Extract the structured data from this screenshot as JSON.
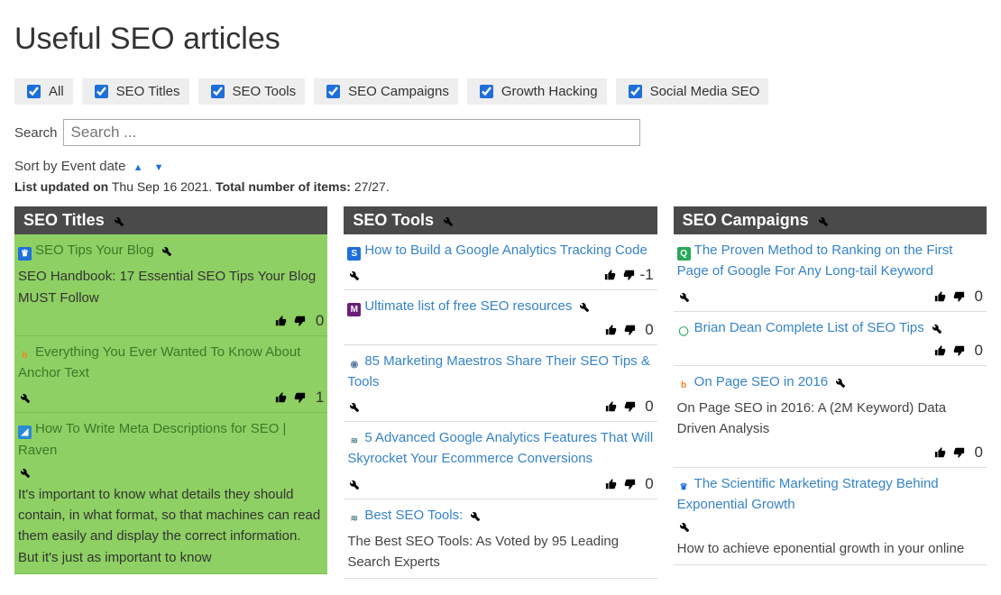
{
  "page_title": "Useful SEO articles",
  "filters": [
    {
      "label": "All",
      "checked": true
    },
    {
      "label": "SEO Titles",
      "checked": true
    },
    {
      "label": "SEO Tools",
      "checked": true
    },
    {
      "label": "SEO Campaigns",
      "checked": true
    },
    {
      "label": "Growth Hacking",
      "checked": true
    },
    {
      "label": "Social Media SEO",
      "checked": true
    }
  ],
  "search": {
    "label": "Search",
    "placeholder": "Search ..."
  },
  "sort": {
    "prefix": "Sort by",
    "field": "Event date"
  },
  "status": {
    "updated_label": "List updated on",
    "updated_value": "Thu Sep 16 2021.",
    "count_label": "Total number of items:",
    "count_value": "27/27."
  },
  "columns": [
    {
      "title": "SEO Titles",
      "green": true,
      "cards": [
        {
          "favicon": {
            "bg": "#1e6fd9",
            "fg": "#fff",
            "glyph": "♛"
          },
          "title": "SEO Tips Your Blog",
          "tools_inline": true,
          "desc": "SEO Handbook: 17 Essential SEO Tips Your Blog MUST Follow",
          "score": "0"
        },
        {
          "favicon": {
            "bg": "transparent",
            "fg": "#f58220",
            "glyph": "b"
          },
          "title": "Everything You Ever Wanted To Know About Anchor Text",
          "tools_below": true,
          "score": "1"
        },
        {
          "favicon": {
            "bg": "#2a8ad4",
            "fg": "#fff",
            "glyph": "◢"
          },
          "title": "How To Write Meta Descriptions for SEO | Raven",
          "tools_below": true,
          "desc": "It's important to know what details they should contain, in what format, so that machines can read them easily and display the correct information. But it's just as important to know"
        }
      ]
    },
    {
      "title": "SEO Tools",
      "green": false,
      "cards": [
        {
          "favicon": {
            "bg": "#1e6fd9",
            "fg": "#fff",
            "glyph": "S"
          },
          "title": "How to Build a Google Analytics Tracking Code",
          "tools_below": true,
          "score": "-1"
        },
        {
          "favicon": {
            "bg": "#6b1d7a",
            "fg": "#fff",
            "glyph": "M"
          },
          "title": "Ultimate list of free SEO resources",
          "tools_inline": true,
          "score": "0"
        },
        {
          "favicon": {
            "bg": "transparent",
            "fg": "#5b7da8",
            "glyph": "◉"
          },
          "title": "85 Marketing Maestros Share Their SEO Tips & Tools",
          "tools_below": true,
          "score": "0"
        },
        {
          "favicon": {
            "bg": "transparent",
            "fg": "#5a8a8a",
            "glyph": "≋"
          },
          "title": "5 Advanced Google Analytics Features That Will Skyrocket Your Ecommerce Conversions",
          "tools_below": true,
          "score": "0"
        },
        {
          "favicon": {
            "bg": "transparent",
            "fg": "#5a8a8a",
            "glyph": "≋"
          },
          "title": "Best SEO Tools:",
          "tools_inline": true,
          "desc": "The Best SEO Tools: As Voted by 95 Leading Search Experts"
        }
      ]
    },
    {
      "title": "SEO Campaigns",
      "green": false,
      "cards": [
        {
          "favicon": {
            "bg": "#2aa85b",
            "fg": "#fff",
            "glyph": "Q"
          },
          "title": "The Proven Method to Ranking on the First Page of Google For Any Long-tail Keyword",
          "tools_below": true,
          "score": "0"
        },
        {
          "favicon": {
            "bg": "transparent",
            "fg": "#2aa85b",
            "glyph": "◯"
          },
          "title": "Brian Dean Complete List of SEO Tips",
          "tools_inline": true,
          "score": "0"
        },
        {
          "favicon": {
            "bg": "transparent",
            "fg": "#f58220",
            "glyph": "b"
          },
          "title": "On Page SEO in 2016",
          "tools_inline": true,
          "desc": "On Page SEO in 2016: A (2M Keyword) Data Driven Analysis",
          "score": "0"
        },
        {
          "favicon": {
            "bg": "transparent",
            "fg": "#1e6fd9",
            "glyph": "♛"
          },
          "title": "The Scientific Marketing Strategy Behind Exponential Growth",
          "tools_below": true,
          "desc": "How to achieve eponential growth in your online"
        }
      ]
    }
  ]
}
